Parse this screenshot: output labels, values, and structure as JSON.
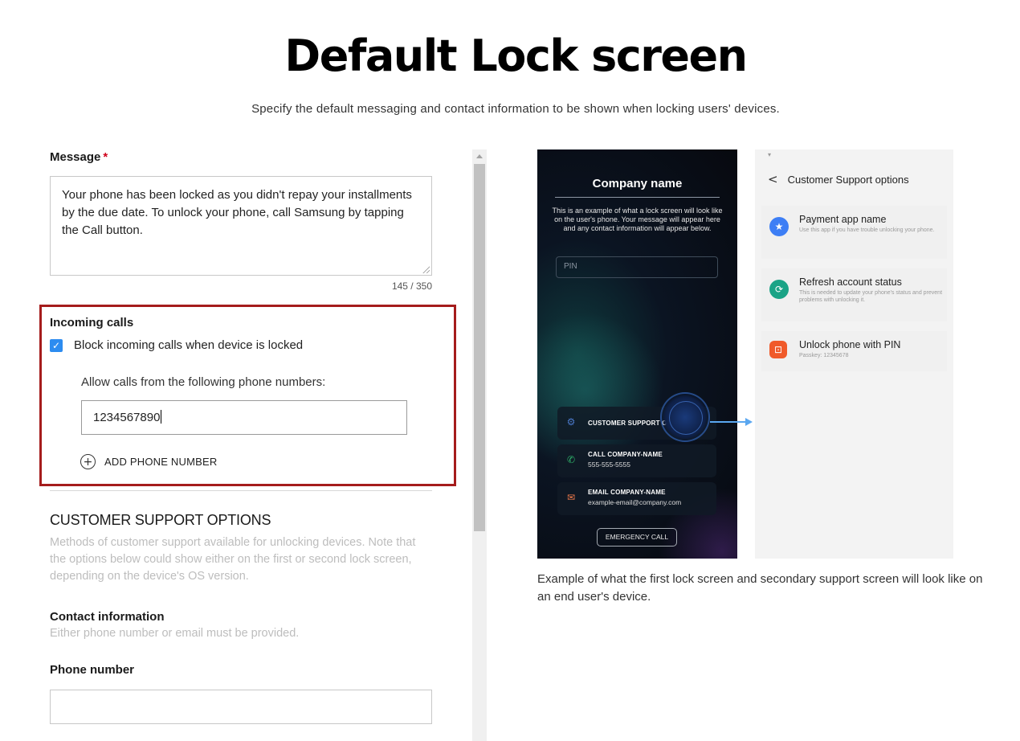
{
  "header": {
    "title": "Default Lock screen",
    "subtitle": "Specify the default messaging and contact information to be shown when locking users' devices."
  },
  "form": {
    "message": {
      "label": "Message",
      "required_mark": "*",
      "value": "Your phone has been locked as you didn't repay your installments by the due date. To unlock your phone, call Samsung  by tapping the Call button.",
      "char_count": "145 / 350"
    },
    "incoming_calls": {
      "label": "Incoming calls",
      "block_checkbox_label": "Block incoming calls when device is locked",
      "block_checked": true,
      "allow_label": "Allow calls from the following phone numbers:",
      "phone_value": "1234567890",
      "add_phone_label": "ADD PHONE NUMBER"
    },
    "customer_support": {
      "title": "CUSTOMER SUPPORT OPTIONS",
      "description": "Methods of customer support available for unlocking devices. Note that the options below could show either on the first or second lock screen, depending on the device's OS version.",
      "contact_label": "Contact information",
      "contact_desc": "Either phone number or email must be provided.",
      "phone_label": "Phone number",
      "phone_value": ""
    }
  },
  "preview": {
    "lock_screen": {
      "company_name": "Company name",
      "description": "This is an example of what a lock screen will look like on the user's phone. Your message will appear here and any contact information will appear below.",
      "pin_placeholder": "PIN",
      "support_option": "CUSTOMER SUPPORT OPTIONS",
      "call_title": "CALL COMPANY-NAME",
      "call_number": "555-555-5555",
      "email_title": "EMAIL COMPANY-NAME",
      "email_address": "example-email@company.com",
      "emergency": "EMERGENCY CALL"
    },
    "support_screen": {
      "back_icon": "chevron-left-icon",
      "title": "Customer Support options",
      "items": [
        {
          "name": "Payment app name",
          "sub": "Use this app if you have trouble unlocking your phone.",
          "icon": "star-icon",
          "color": "#3d7ef5"
        },
        {
          "name": "Refresh account status",
          "sub": "This is needed to update your phone's status and prevent problems with unlocking it.",
          "icon": "refresh-icon",
          "color": "#1aa386"
        },
        {
          "name": "Unlock phone with PIN",
          "sub": "Passkey: 12345678",
          "icon": "lock-open-icon",
          "color": "#f05a2a"
        }
      ]
    },
    "caption": "Example of what the first lock screen and secondary support screen will look like on an end user's device."
  },
  "colors": {
    "highlight_border": "#a51c1c",
    "checkbox": "#2d8cf0",
    "arrow": "#5aa7f0",
    "required": "#d0021b"
  }
}
